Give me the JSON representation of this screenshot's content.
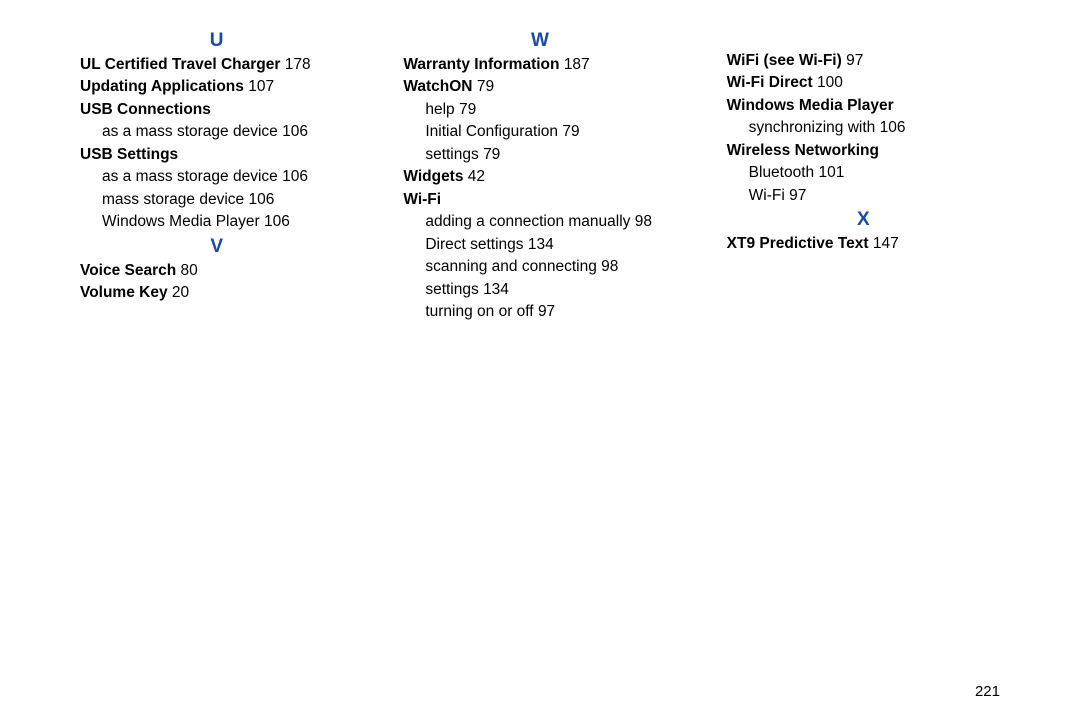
{
  "page_number": "221",
  "columns": [
    {
      "sections": [
        {
          "letter": "U",
          "lines": [
            {
              "bold": "UL Certified Travel Charger",
              "page": "178",
              "indent": 0
            },
            {
              "bold": "Updating Applications",
              "page": "107",
              "indent": 0
            },
            {
              "bold": "USB Connections",
              "page": "",
              "indent": 0
            },
            {
              "text": "as a mass storage device",
              "page": "106",
              "indent": 1
            },
            {
              "bold": "USB Settings",
              "page": "",
              "indent": 0
            },
            {
              "text": "as a mass storage device",
              "page": "106",
              "indent": 1
            },
            {
              "text": "mass storage device",
              "page": "106",
              "indent": 1
            },
            {
              "text": "Windows Media Player",
              "page": "106",
              "indent": 1
            }
          ]
        },
        {
          "letter": "V",
          "lines": [
            {
              "bold": "Voice Search",
              "page": "80",
              "indent": 0
            },
            {
              "bold": "Volume Key",
              "page": "20",
              "indent": 0
            }
          ]
        }
      ]
    },
    {
      "sections": [
        {
          "letter": "W",
          "lines": [
            {
              "bold": "Warranty Information",
              "page": "187",
              "indent": 0
            },
            {
              "bold": "WatchON",
              "page": "79",
              "indent": 0
            },
            {
              "text": "help",
              "page": "79",
              "indent": 1
            },
            {
              "text": "Initial Configuration",
              "page": "79",
              "indent": 1
            },
            {
              "text": "settings",
              "page": "79",
              "indent": 1
            },
            {
              "bold": "Widgets",
              "page": "42",
              "indent": 0
            },
            {
              "bold": "Wi-Fi",
              "page": "",
              "indent": 0
            },
            {
              "text": "adding a connection manually",
              "page": "98",
              "indent": 1
            },
            {
              "text": "Direct settings",
              "page": "134",
              "indent": 1
            },
            {
              "text": "scanning and connecting",
              "page": "98",
              "indent": 1
            },
            {
              "text": "settings",
              "page": "134",
              "indent": 1
            },
            {
              "text": "turning on or off",
              "page": "97",
              "indent": 1
            }
          ]
        }
      ]
    },
    {
      "sections": [
        {
          "letter": "",
          "lines": [
            {
              "bold": "WiFi (see Wi-Fi)",
              "page": "97",
              "indent": 0
            },
            {
              "bold": "Wi-Fi Direct",
              "page": "100",
              "indent": 0
            },
            {
              "bold": "Windows Media Player",
              "page": "",
              "indent": 0
            },
            {
              "text": "synchronizing with",
              "page": "106",
              "indent": 1
            },
            {
              "bold": "Wireless Networking",
              "page": "",
              "indent": 0
            },
            {
              "text": "Bluetooth",
              "page": "101",
              "indent": 1
            },
            {
              "text": "Wi-Fi",
              "page": "97",
              "indent": 1
            }
          ]
        },
        {
          "letter": "X",
          "lines": [
            {
              "bold": "XT9 Predictive Text",
              "page": "147",
              "indent": 0
            }
          ]
        }
      ]
    }
  ]
}
